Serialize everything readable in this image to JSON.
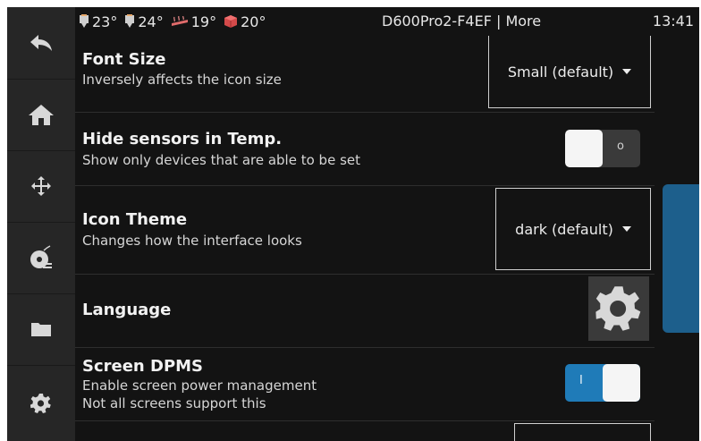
{
  "topbar": {
    "temps": [
      {
        "icon": "extruder-icon",
        "value": "23°"
      },
      {
        "icon": "extruder-icon",
        "value": "24°"
      },
      {
        "icon": "heated-bed-icon",
        "value": "19°"
      },
      {
        "icon": "chamber-cube-icon",
        "value": "20°"
      }
    ],
    "title": "D600Pro2-F4EF | More",
    "clock": "13:41"
  },
  "sidebar": {
    "items": [
      {
        "icon": "back-arrow-icon"
      },
      {
        "icon": "home-icon"
      },
      {
        "icon": "move-arrows-icon"
      },
      {
        "icon": "filament-spool-icon"
      },
      {
        "icon": "folder-icon"
      },
      {
        "icon": "settings-gear-icon"
      }
    ]
  },
  "settings": {
    "font_size": {
      "title": "Font Size",
      "desc": "Inversely affects the icon size",
      "value": "Small (default)"
    },
    "hide_sensors": {
      "title": "Hide sensors in Temp.",
      "desc": "Show only devices that are able to be set",
      "switch_mark": "o",
      "state": "off"
    },
    "icon_theme": {
      "title": "Icon Theme",
      "desc": "Changes how the interface looks",
      "value": "dark (default)"
    },
    "language": {
      "title": "Language"
    },
    "screen_dpms": {
      "title": "Screen DPMS",
      "desc1": "Enable screen power management",
      "desc2": "Not all screens support this",
      "switch_mark": "I",
      "state": "on"
    }
  },
  "colors": {
    "background": "#131313",
    "sidebar": "#262626",
    "accent": "#1f7bb8",
    "scrollbar": "#1d5f8c"
  }
}
